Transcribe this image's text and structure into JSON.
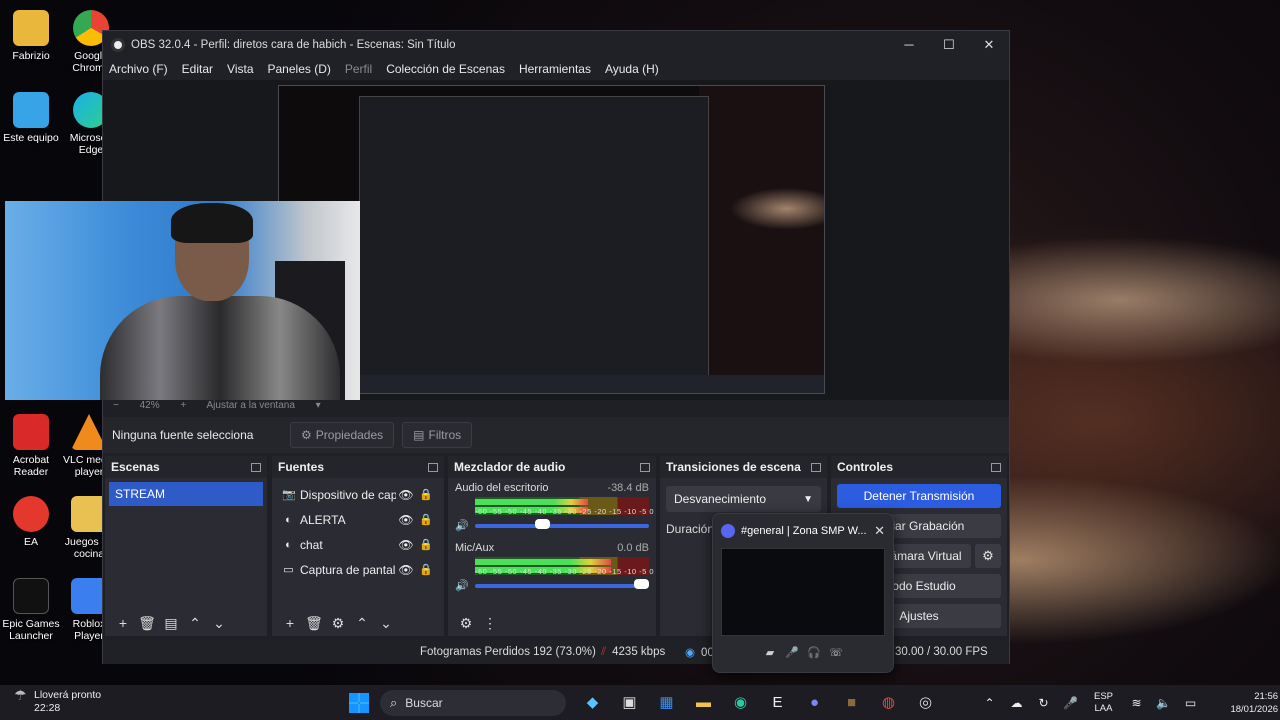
{
  "desktop": {
    "icons": [
      {
        "label": "Fabrizio"
      },
      {
        "label": "Google Chrome"
      },
      {
        "label": "Este equipo"
      },
      {
        "label": "Microsoft Edge"
      },
      {
        "label": "Acrobat Reader"
      },
      {
        "label": "VLC media player"
      },
      {
        "label": "EA"
      },
      {
        "label": "Juegos de cocina"
      },
      {
        "label": "Epic Games Launcher"
      },
      {
        "label": "Roblox Player"
      }
    ]
  },
  "window": {
    "title": "OBS 32.0.4 - Perfil: diretos cara de habich - Escenas: Sin Título",
    "minimize": "─",
    "maximize": "☐",
    "close": "✕"
  },
  "menu": [
    "Archivo (F)",
    "Editar",
    "Vista",
    "Paneles (D)",
    "Perfil",
    "Colección de Escenas",
    "Herramientas",
    "Ayuda (H)"
  ],
  "zoombar": {
    "zoom": "42%",
    "plus": "+",
    "fit": "Ajustar a la ventana",
    "caret": "▾",
    "minus": "−"
  },
  "source_toolbar": {
    "no_selection": "Ninguna fuente selecciona",
    "properties": "Propiedades",
    "filters": "Filtros"
  },
  "docks": {
    "scenes": {
      "title": "Escenas",
      "items": [
        "STREAM"
      ]
    },
    "sources": {
      "title": "Fuentes",
      "items": [
        {
          "label": "Dispositivo de capt",
          "icon": "camera-icon"
        },
        {
          "label": "ALERTA",
          "icon": "globe-icon"
        },
        {
          "label": "chat",
          "icon": "globe-icon"
        },
        {
          "label": "Captura de pantall",
          "icon": "monitor-icon"
        }
      ]
    },
    "mixer": {
      "title": "Mezclador de audio",
      "scale": "-60 -55 -50 -45 -40 -35 -30 -25 -20 -15 -10  -5  0",
      "channels": [
        {
          "name": "Audio del escritorio",
          "db": "-38.4 dB",
          "level": 0.65,
          "volume": 0.38
        },
        {
          "name": "Mic/Aux",
          "db": "0.0 dB",
          "level": 0.78,
          "volume": 1.0
        }
      ]
    },
    "transitions": {
      "title": "Transiciones de escena",
      "selected": "Desvanecimiento",
      "duration_label": "Duración"
    },
    "controls": {
      "title": "Controles",
      "stop_stream": "Detener Transmisión",
      "recording": "Iniciar Grabación",
      "virtual_cam": "Iniciar Cámara Virtual",
      "studio_mode": "Modo Estudio",
      "settings": "Ajustes"
    }
  },
  "status": {
    "dropped": "Fotogramas Perdidos 192 (73.0%)",
    "kbps": "4235 kbps",
    "time": "00",
    "fps": "30.00 / 30.00 FPS"
  },
  "popup": {
    "title": "#general | Zona SMP W...",
    "close": "✕"
  },
  "taskbar": {
    "weather_line1": "Lloverá pronto",
    "weather_line2": "22:28",
    "search": "Buscar",
    "lang_line1": "ESP",
    "lang_line2": "LAA",
    "time": "21:56",
    "date": "18/01/2026"
  },
  "colors": {
    "accent": "#2c5ce0",
    "scene_selected": "#2e5bc8",
    "discord": "#5865f2"
  }
}
